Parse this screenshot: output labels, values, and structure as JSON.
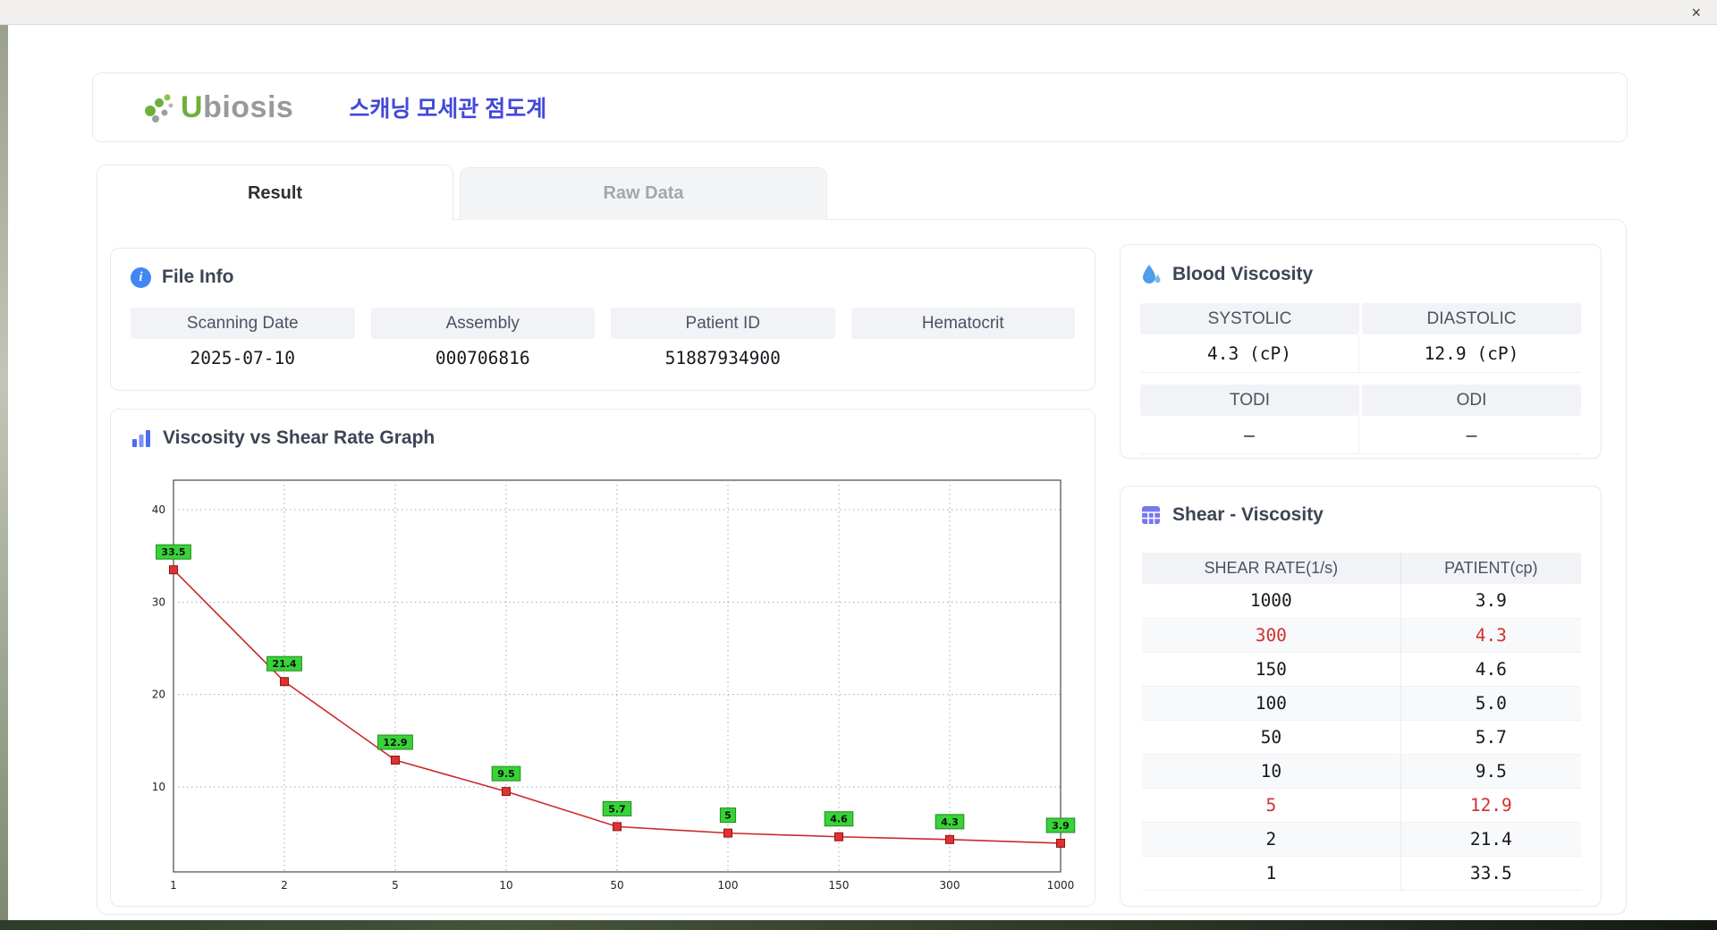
{
  "window": {
    "close_label": "×"
  },
  "header": {
    "logo_u": "U",
    "logo_rest": "biosis",
    "logo_color": "#6faf3e",
    "title": "스캐닝 모세관 점도계",
    "title_color": "#4249d8"
  },
  "tabs": [
    {
      "label": "Result",
      "active": true
    },
    {
      "label": "Raw Data",
      "active": false
    }
  ],
  "file_info": {
    "title": "File Info",
    "fields": [
      {
        "label": "Scanning Date",
        "value": "2025-07-10"
      },
      {
        "label": "Assembly",
        "value": "000706816"
      },
      {
        "label": "Patient ID",
        "value": "51887934900"
      },
      {
        "label": "Hematocrit",
        "value": ""
      }
    ]
  },
  "blood_viscosity": {
    "title": "Blood Viscosity",
    "pairs": [
      {
        "labels": [
          "SYSTOLIC",
          "DIASTOLIC"
        ],
        "values": [
          "4.3 (cP)",
          "12.9 (cP)"
        ]
      },
      {
        "labels": [
          "TODI",
          "ODI"
        ],
        "values": [
          "–",
          "–"
        ]
      }
    ]
  },
  "graph": {
    "title": "Viscosity vs Shear Rate Graph"
  },
  "shear_viscosity": {
    "title": "Shear - Viscosity",
    "columns": [
      "SHEAR RATE(1/s)",
      "PATIENT(cp)"
    ],
    "highlight_color": "#d32f2f",
    "rows": [
      {
        "shear_rate": "1000",
        "patient": "3.9",
        "highlight": false
      },
      {
        "shear_rate": "300",
        "patient": "4.3",
        "highlight": true
      },
      {
        "shear_rate": "150",
        "patient": "4.6",
        "highlight": false
      },
      {
        "shear_rate": "100",
        "patient": "5.0",
        "highlight": false
      },
      {
        "shear_rate": "50",
        "patient": "5.7",
        "highlight": false
      },
      {
        "shear_rate": "10",
        "patient": "9.5",
        "highlight": false
      },
      {
        "shear_rate": "5",
        "patient": "12.9",
        "highlight": true
      },
      {
        "shear_rate": "2",
        "patient": "21.4",
        "highlight": false
      },
      {
        "shear_rate": "1",
        "patient": "33.5",
        "highlight": false
      }
    ]
  },
  "chart_data": {
    "type": "line",
    "title": "Viscosity vs Shear Rate Graph",
    "x_categories": [
      "1",
      "2",
      "5",
      "10",
      "50",
      "100",
      "150",
      "300",
      "1000"
    ],
    "series": [
      {
        "name": "PATIENT(cp)",
        "values": [
          33.5,
          21.4,
          12.9,
          9.5,
          5.7,
          5.0,
          4.6,
          4.3,
          3.9
        ]
      }
    ],
    "point_labels": [
      "33.5",
      "21.4",
      "12.9",
      "9.5",
      "5.7",
      "5",
      "4.6",
      "4.3",
      "3.9"
    ],
    "yticks": [
      10,
      20,
      30,
      40
    ],
    "ylim": [
      0.8,
      43.2
    ],
    "grid": "dotted",
    "legend": "none",
    "line_color": "#c92a2a",
    "marker_color": "#e03131",
    "marker_shape": "square",
    "label_box_color": "#37d337",
    "label_box_border": "#1f8a1f"
  }
}
